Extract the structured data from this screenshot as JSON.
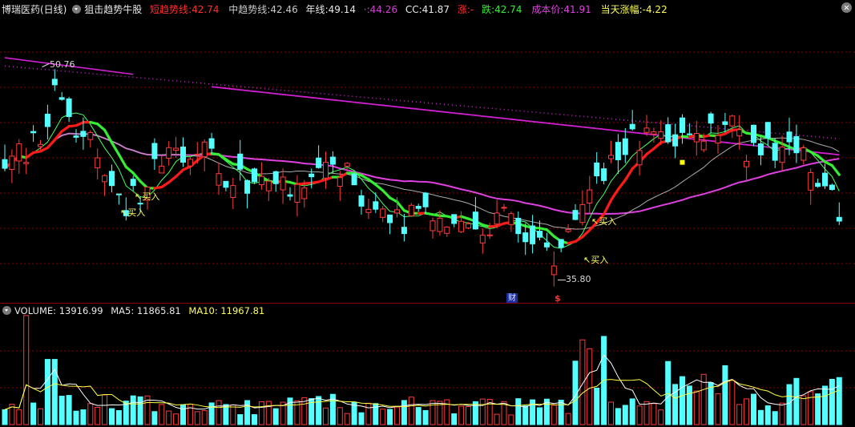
{
  "header": {
    "stock_name": "博瑞医药(日线)",
    "indicator_name": "狙击趋势牛股",
    "short_trend_label": "短趋势线",
    "short_trend_value": "42.74",
    "mid_trend_label": "中趋势线",
    "mid_trend_value": "42.46",
    "year_line_label": "年线",
    "year_line_value": "49.14",
    "dots_label": "·",
    "dots_value": "44.26",
    "cc_label": "CC",
    "cc_value": "41.87",
    "rise_label": "涨",
    "rise_value": "-",
    "fall_label": "跌",
    "fall_value": "42.74",
    "cost_label": "成本价",
    "cost_value": "41.91",
    "day_change_label": "当天涨幅",
    "day_change_value": "-4.22"
  },
  "volume_header": {
    "label": "VOLUME",
    "value": "13916.99",
    "ma5_label": "MA5",
    "ma5_value": "11865.81",
    "ma10_label": "MA10",
    "ma10_value": "11967.81"
  },
  "annotations": {
    "high_label": "50.76",
    "low_label": "35.80",
    "buy_label": "买入",
    "finance_marker": "财",
    "event_marker": "$"
  },
  "colors": {
    "up": "#ff3b3b",
    "down": "#54ffff",
    "short_trend_up": "#ff1a1a",
    "short_trend_down": "#33ee33",
    "mid_trend": "#e040e0",
    "year_line": "#d020d0",
    "cc_line": "#aaaaaa",
    "gridline": "#8b0000"
  },
  "chart_data": {
    "type": "candlestick",
    "price_range": [
      35.8,
      50.76
    ],
    "days": 118,
    "seed": 20240521
  }
}
